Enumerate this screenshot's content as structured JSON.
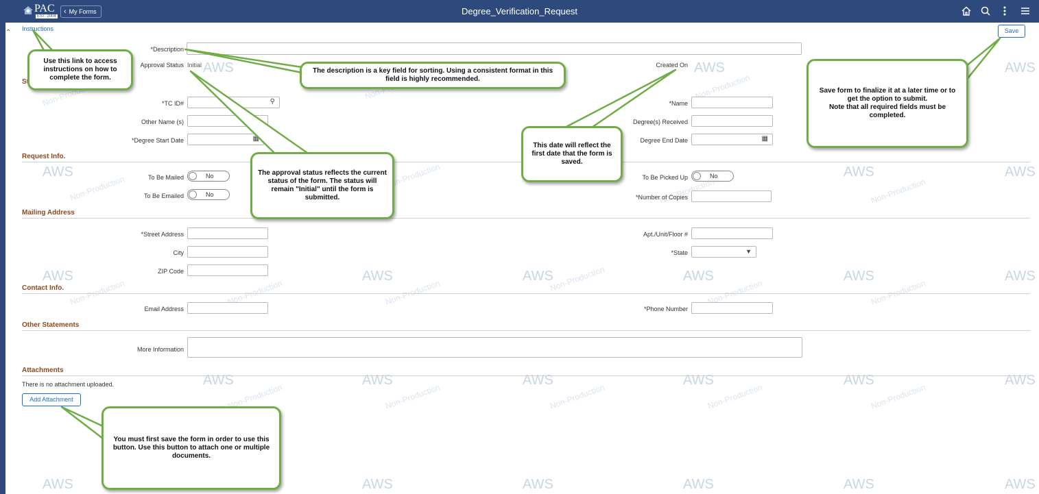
{
  "header": {
    "logo_text": "PAC",
    "logo_est": "EST. 2004",
    "back_button_label": "My Forms",
    "title": "Degree_Verification_Request",
    "icons": [
      "home-icon",
      "search-icon",
      "more-vertical-icon",
      "hamburger-menu-icon"
    ]
  },
  "toolbar": {
    "instructions_link": "Instructions",
    "save_label": "Save"
  },
  "form": {
    "description_label": "*Description",
    "approval_status_label": "Approval Status",
    "approval_status_value": "Initial",
    "created_on_label": "Created On",
    "tcid_label": "*TC ID#",
    "name_label": "*Name",
    "other_name_label": "Other Name (s)",
    "degrees_received_label": "Degree(s) Received",
    "degree_start_label": "*Degree Start Date",
    "degree_end_label": "Degree End Date"
  },
  "request_info": {
    "section_title": "Request Info.",
    "mailed_label": "To Be Mailed",
    "mailed_value": "No",
    "emailed_label": "To Be Emailed",
    "emailed_value": "No",
    "picked_up_label": "To Be Picked Up",
    "picked_up_value": "No",
    "copies_label": "*Number of Copies"
  },
  "mailing": {
    "section_title": "Mailing Address",
    "street_label": "*Street Address",
    "apt_label": "Apt./Unit/Floor #",
    "city_label": "City",
    "state_label": "*State",
    "zip_label": "ZIP Code"
  },
  "contact": {
    "section_title": "Contact Info.",
    "email_label": "Email Address",
    "phone_label": "*Phone Number"
  },
  "other": {
    "section_title": "Other Statements",
    "more_info_label": "More Information"
  },
  "attachments": {
    "section_title": "Attachments",
    "empty_text": "There is no attachment uploaded.",
    "add_button": "Add Attachment"
  },
  "watermark": {
    "brand": "AWS",
    "env": "Non-Production"
  },
  "callouts": {
    "instructions": "Use this link to access instructions on how to complete the form.",
    "description": "The description is a key field for sorting. Using a consistent format in this field is highly recommended.",
    "approval": "The approval status reflects the current status of the form. The status will remain \"Initial\" until the form is submitted.",
    "created_on": "This date will reflect the first date that the form is saved.",
    "save": "Save form to finalize it at a later time or to get the option to submit.\nNote that all required fields must be completed.",
    "attachment": "You must first  save the form in order to use this button. Use this button to attach one or multiple documents."
  }
}
